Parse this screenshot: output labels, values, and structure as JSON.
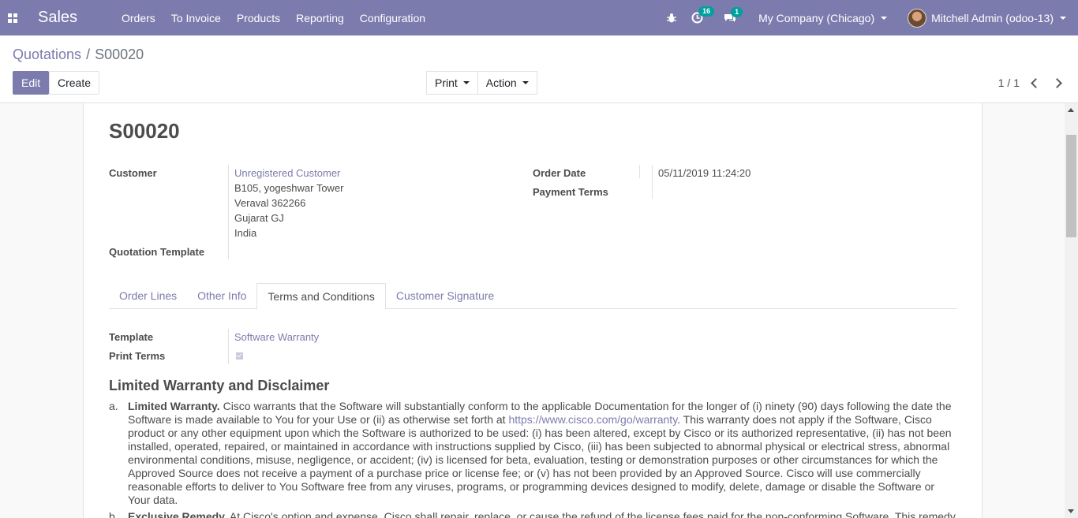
{
  "navbar": {
    "app_name": "Sales",
    "menu": [
      "Orders",
      "To Invoice",
      "Products",
      "Reporting",
      "Configuration"
    ],
    "activity_count": "16",
    "message_count": "1",
    "company": "My Company (Chicago)",
    "user": "Mitchell Admin (odoo-13)"
  },
  "breadcrumb": {
    "parent": "Quotations",
    "separator": "/",
    "current": "S00020"
  },
  "toolbar": {
    "edit": "Edit",
    "create": "Create",
    "print": "Print",
    "action": "Action"
  },
  "pager": {
    "value": "1 / 1"
  },
  "form": {
    "name": "S00020",
    "customer_label": "Customer",
    "customer_name": "Unregistered Customer",
    "customer_address": [
      "B105, yogeshwar Tower",
      "Veraval 362266",
      "Gujarat GJ",
      "India"
    ],
    "quotation_template_label": "Quotation Template",
    "order_date_label": "Order Date",
    "order_date": "05/11/2019 11:24:20",
    "payment_terms_label": "Payment Terms"
  },
  "tabs": [
    "Order Lines",
    "Other Info",
    "Terms and Conditions",
    "Customer Signature"
  ],
  "terms": {
    "template_label": "Template",
    "template_value": "Software Warranty",
    "print_terms_label": "Print Terms",
    "print_terms_checked": true,
    "title": "Limited Warranty and Disclaimer",
    "item_a_mark": "a.",
    "item_a_title": "Limited Warranty.",
    "item_a_text_1": " Cisco warrants that the Software will substantially conform to the applicable Documentation for the longer of (i) ninety (90) days following the date the Software is made available to You for your Use or (ii) as otherwise set forth at ",
    "item_a_link": "https://www.cisco.com/go/warranty",
    "item_a_text_2": ". This warranty does not apply if the Software, Cisco product or any other equipment upon which the Software is authorized to be used: (i) has been altered, except by Cisco or its authorized representative, (ii) has not been installed, operated, repaired, or maintained in accordance with instructions supplied by Cisco, (iii) has been subjected to abnormal physical or electrical stress, abnormal environmental conditions, misuse, negligence, or accident; (iv) is licensed for beta, evaluation, testing or demonstration purposes or other circumstances for which the Approved Source does not receive a payment of a purchase price or license fee; or (v) has not been provided by an Approved Source. Cisco will use commercially reasonable efforts to deliver to You Software free from any viruses, programs, or programming devices designed to modify, delete, damage or disable the Software or Your data.",
    "item_b_mark": "b.",
    "item_b_title": "Exclusive Remedy.",
    "item_b_text": " At Cisco's option and expense, Cisco shall repair, replace, or cause the refund of the license fees paid for the non-conforming Software. This remedy"
  },
  "colors": {
    "primary": "#7c7bad",
    "badge": "#00a09d"
  }
}
